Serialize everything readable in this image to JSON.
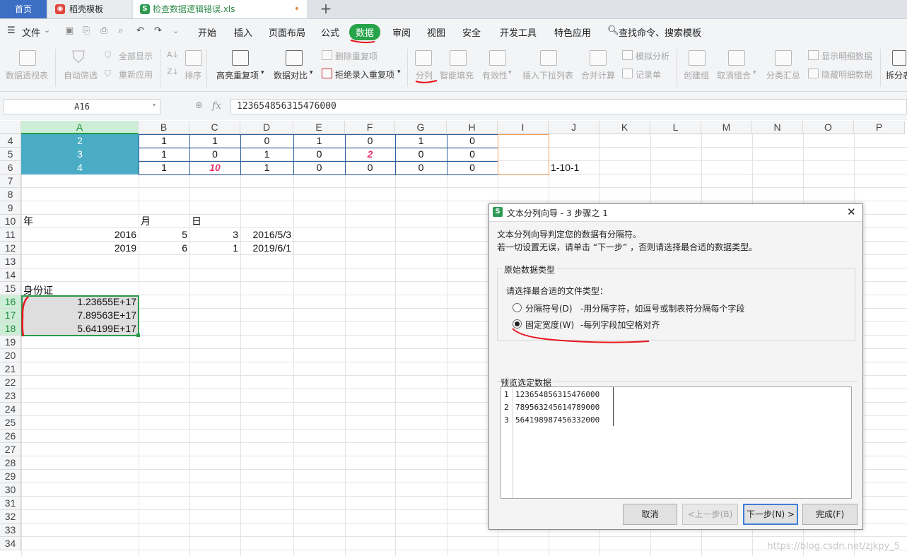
{
  "tabs": {
    "home": "首页",
    "template": "稻壳模板",
    "file": "检查数据逻辑错误.xls",
    "modified_dot": "•",
    "add": "+"
  },
  "menu": {
    "file": "文件",
    "items": [
      "开始",
      "插入",
      "页面布局",
      "公式",
      "数据",
      "审阅",
      "视图",
      "安全",
      "开发工具",
      "特色应用"
    ],
    "search": "查找命令、搜索模板"
  },
  "ribbon": {
    "pivot": "数据透视表",
    "autofilter": "自动筛选",
    "show_all": "全部显示",
    "reapply": "重新应用",
    "sort": "排序",
    "highlight_dup": "高亮重复项",
    "compare": "数据对比",
    "remove_dup": "删除重复项",
    "reject_dup": "拒绝录入重复项",
    "split": "分列",
    "smart_fill": "智能填充",
    "validity": "有效性",
    "dropdown": "插入下拉列表",
    "consolidate": "合并计算",
    "simulate": "模拟分析",
    "record": "记录单",
    "group": "创建组",
    "ungroup": "取消组合",
    "subtotal": "分类汇总",
    "show_detail": "显示明细数据",
    "hide_detail": "隐藏明细数据",
    "split_table": "拆分表"
  },
  "formula_bar": {
    "name_box": "A16",
    "fx": "fx",
    "value": "123654856315476000"
  },
  "columns": [
    "A",
    "B",
    "C",
    "D",
    "E",
    "F",
    "G",
    "H",
    "I",
    "J",
    "K",
    "L",
    "M",
    "N",
    "O",
    "P"
  ],
  "rows": [
    "4",
    "5",
    "6",
    "7",
    "8",
    "9",
    "10",
    "11",
    "12",
    "13",
    "14",
    "15",
    "16",
    "17",
    "18",
    "19",
    "20",
    "21",
    "22",
    "23",
    "24",
    "25",
    "26",
    "27",
    "28",
    "29",
    "30",
    "31",
    "32",
    "33",
    "34"
  ],
  "cells": {
    "A4": "2",
    "B4": "1",
    "C4": "1",
    "D4": "0",
    "E4": "1",
    "F4": "0",
    "G4": "1",
    "H4": "0",
    "A5": "3",
    "B5": "1",
    "C5": "0",
    "D5": "1",
    "E5": "0",
    "F5": "2",
    "G5": "0",
    "H5": "0",
    "A6": "4",
    "B6": "1",
    "C6": "10",
    "D6": "1",
    "E6": "0",
    "F6": "0",
    "G6": "0",
    "H6": "0",
    "J6": "1-10-1",
    "A10": "年",
    "B10": "月",
    "C10": "日",
    "A11": "2016",
    "B11": "5",
    "C11": "3",
    "D11": "2016/5/3",
    "A12": "2019",
    "B12": "6",
    "C12": "1",
    "D12": "2019/6/1",
    "A15": "身份证",
    "A16": "1.23655E+17",
    "A17": "7.89563E+17",
    "A18": "5.64199E+17"
  },
  "dialog": {
    "icon": "S",
    "title": "文本分列向导 - 3 步骤之 1",
    "close": "✕",
    "intro1": "文本分列向导判定您的数据有分隔符。",
    "intro2": "若一切设置无误，请单击 “下一步” ，否则请选择最合适的数据类型。",
    "group_title": "原始数据类型",
    "prompt": "请选择最合适的文件类型：",
    "opt_delimited": "分隔符号(D)",
    "opt_delimited_desc": "-用分隔字符，如逗号或制表符分隔每个字段",
    "opt_fixed": "固定宽度(W)",
    "opt_fixed_desc": "-每列字段加空格对齐",
    "preview_title": "预览选定数据",
    "preview_lines": [
      {
        "num": "1",
        "text": "123654856315476000"
      },
      {
        "num": "2",
        "text": "789563245614789000"
      },
      {
        "num": "3",
        "text": "564198987456332000"
      }
    ],
    "btn_cancel": "取消",
    "btn_prev": "<上一步(B)",
    "btn_next": "下一步(N) >",
    "btn_finish": "完成(F)"
  },
  "watermark": "https://blog.csdn.net/zjkpy_5",
  "colors": {
    "accent_green": "#27a34a",
    "header_fill": "#4bacc6",
    "annotation_red": "#e8141c",
    "emphasis_pink": "#e8356b"
  }
}
